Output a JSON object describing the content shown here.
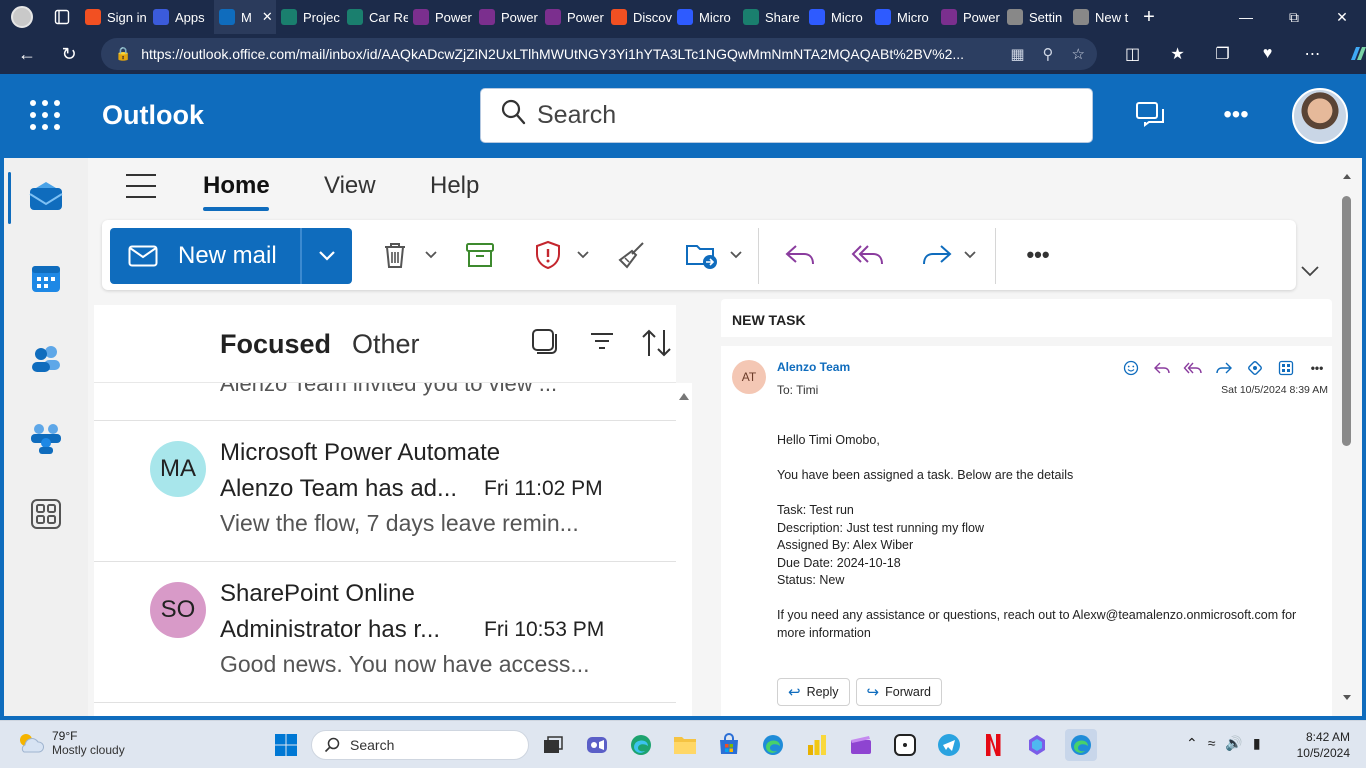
{
  "browser": {
    "tabs": [
      {
        "label": "Sign in",
        "color": "#f25022"
      },
      {
        "label": "Apps",
        "color": "#3b5bdb"
      },
      {
        "label": "M",
        "color": "#0f6cbd",
        "active": true
      },
      {
        "label": "Projec",
        "color": "#1a7f6e"
      },
      {
        "label": "Car Re",
        "color": "#1a7f6e"
      },
      {
        "label": "Power",
        "color": "#7b2f8e"
      },
      {
        "label": "Power",
        "color": "#7b2f8e"
      },
      {
        "label": "Power",
        "color": "#7b2f8e"
      },
      {
        "label": "Discov",
        "color": "#f25022"
      },
      {
        "label": "Micro",
        "color": "#2e5bff"
      },
      {
        "label": "Share",
        "color": "#1a7f6e"
      },
      {
        "label": "Micro",
        "color": "#2e5bff"
      },
      {
        "label": "Micro",
        "color": "#2e5bff"
      },
      {
        "label": "Power",
        "color": "#7b2f8e"
      },
      {
        "label": "Settin",
        "color": "#888888"
      },
      {
        "label": "New t",
        "color": "#888888"
      }
    ],
    "url": "https://outlook.office.com/mail/inbox/id/AAQkADcwZjZiN2UxLTlhMWUtNGY3Yi1hYTA3LTc1NGQwMmNmNTA2MQAQABt%2BV%2..."
  },
  "outlook": {
    "app_name": "Outlook",
    "search_placeholder": "Search",
    "ribbon_tabs": [
      "Home",
      "View",
      "Help"
    ],
    "new_mail_label": "New mail",
    "pivots": {
      "focused": "Focused",
      "other": "Other"
    },
    "partial_row_text": "Alenzo Team invited you to view ...",
    "messages": [
      {
        "initials": "MA",
        "avatar_color": "#a8e6eb",
        "sender": "Microsoft Power Automate",
        "subject": "Alenzo Team has ad...",
        "time": "Fri 11:02 PM",
        "preview": "View the flow, 7 days leave remin..."
      },
      {
        "initials": "SO",
        "avatar_color": "#d89ac8",
        "sender": "SharePoint Online",
        "subject": "Administrator has r...",
        "time": "Fri 10:53 PM",
        "preview": "Good news. You now have access..."
      }
    ],
    "reading": {
      "subject": "NEW TASK",
      "avatar_initials": "AT",
      "from": "Alenzo Team",
      "to": "To:  Timi",
      "date": "Sat 10/5/2024 8:39 AM",
      "greeting": "Hello Timi Omobo,",
      "intro": "You have been assigned a task. Below are the details",
      "task": "Task: Test run",
      "description": "Description: Just test running my flow",
      "assigned_by": "Assigned By: Alex Wiber",
      "due_date": "Due Date: 2024-10-18",
      "status": "Status: New",
      "footer": "If you need any assistance or questions, reach out to Alexw@teamalenzo.onmicrosoft.com for more information",
      "reply_label": "Reply",
      "forward_label": "Forward"
    }
  },
  "taskbar": {
    "temperature": "79°F",
    "condition": "Mostly cloudy",
    "search_label": "Search",
    "time": "8:42 AM",
    "date": "10/5/2024"
  }
}
